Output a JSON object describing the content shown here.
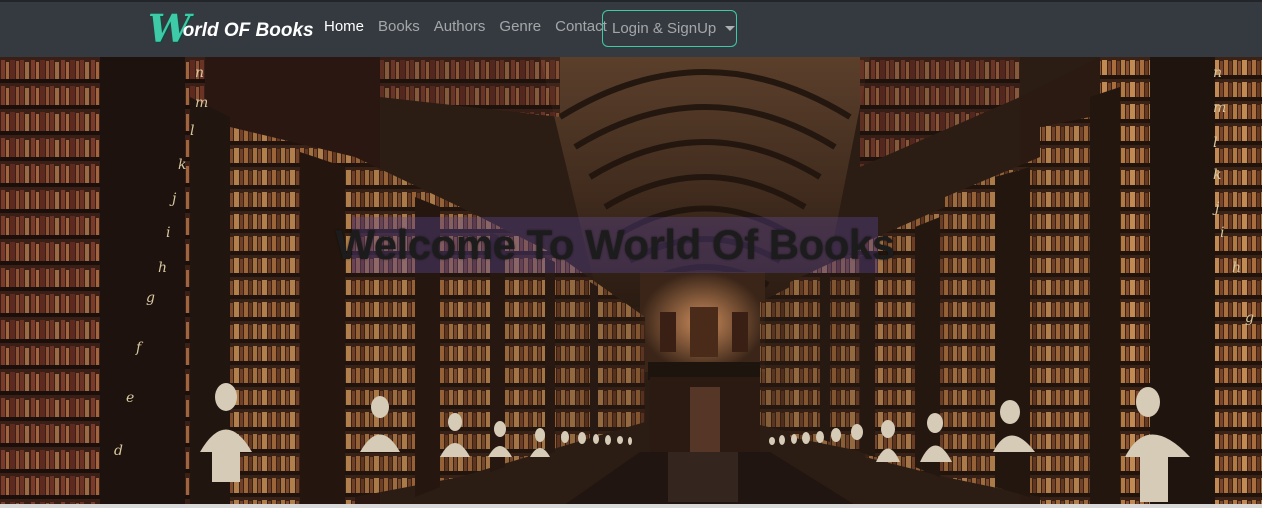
{
  "brand": {
    "initial": "W",
    "rest": "orld OF Books"
  },
  "nav": {
    "items": [
      {
        "label": "Home",
        "active": true
      },
      {
        "label": "Books",
        "active": false
      },
      {
        "label": "Authors",
        "active": false
      },
      {
        "label": "Genre",
        "active": false
      },
      {
        "label": "Contact",
        "active": false
      }
    ],
    "login_label": "Login & SignUp"
  },
  "hero": {
    "title": "Welcome To World Of Books"
  },
  "colors": {
    "navbar": "#343a40",
    "accent": "#3ec9a7",
    "nav_inactive": "rgba(255,255,255,0.55)",
    "title_overlay": "rgba(95,75,160,0.35)"
  }
}
